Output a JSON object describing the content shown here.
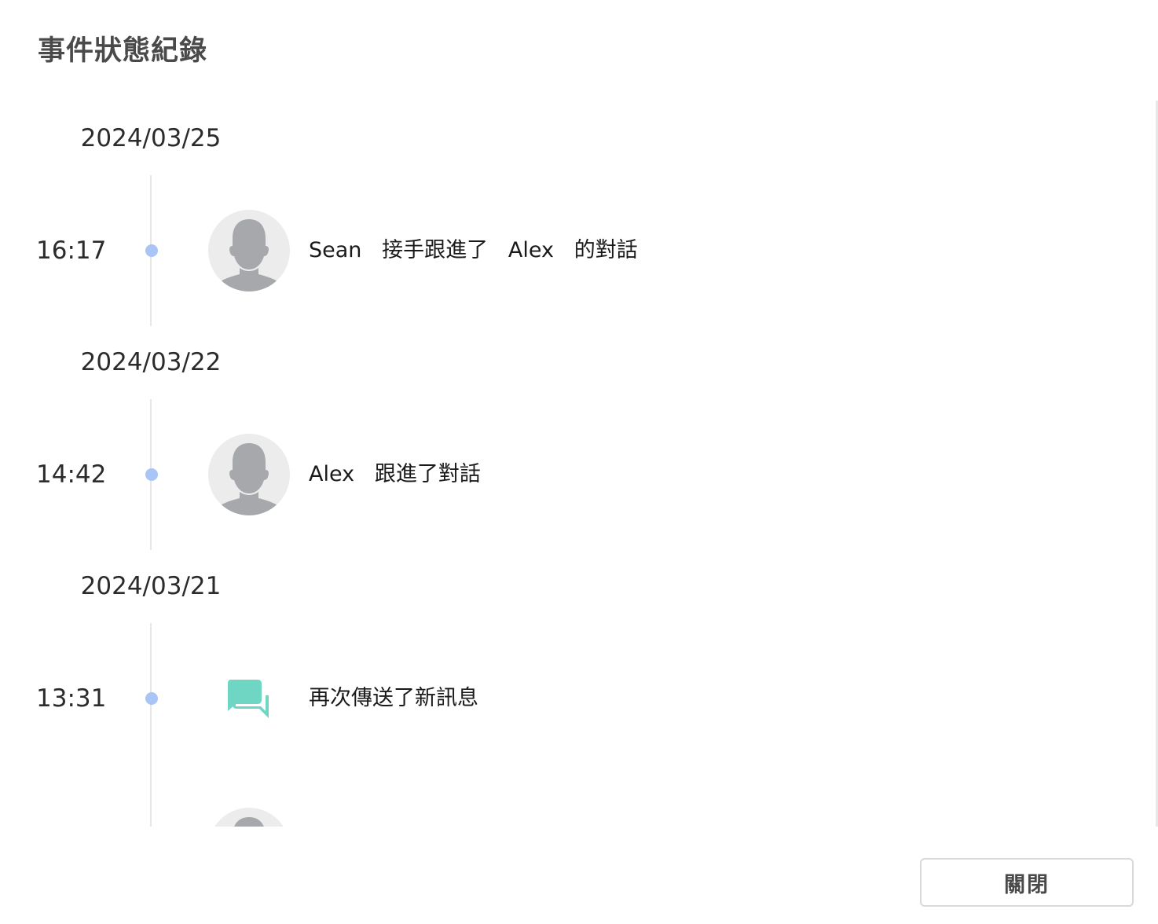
{
  "dialog": {
    "title": "事件狀態紀錄",
    "close_label": "關閉"
  },
  "groups": [
    {
      "date": "2024/03/25",
      "events": [
        {
          "time": "16:17",
          "icon": "user-avatar-icon",
          "text": "Sean   接手跟進了   Alex   的對話"
        }
      ]
    },
    {
      "date": "2024/03/22",
      "events": [
        {
          "time": "14:42",
          "icon": "user-avatar-icon",
          "text": "Alex   跟進了對話"
        }
      ]
    },
    {
      "date": "2024/03/21",
      "events": [
        {
          "time": "13:31",
          "icon": "chat-bubbles-icon",
          "text": "再次傳送了新訊息"
        },
        {
          "time": "",
          "icon": "user-avatar-icon",
          "text": ""
        }
      ]
    }
  ],
  "colors": {
    "timeline_dot": "#a9c5f5",
    "message_icon": "#6fd6c4",
    "avatar_bg": "#ececed",
    "avatar_silhouette": "#a6a8ab"
  }
}
